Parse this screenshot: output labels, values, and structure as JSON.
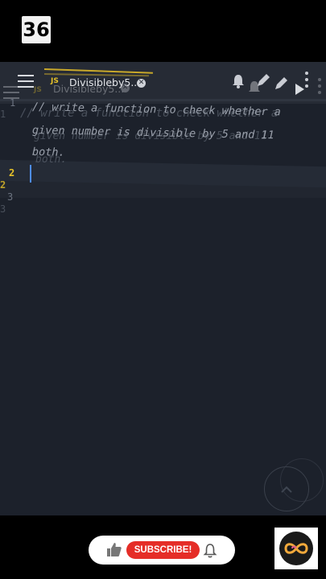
{
  "badge": {
    "label": "36"
  },
  "toolbar": {
    "tab": {
      "lang": "JS",
      "title": "Divisibleby5..",
      "title_ghost": "Divisibleby5..."
    }
  },
  "editor": {
    "gutter": [
      "1",
      "2",
      "3"
    ],
    "gutter_ghost": [
      "1",
      "2",
      "3"
    ],
    "lines": [
      "// write a function to check whether a",
      "  given number is divisible by 5 and 11",
      "  both."
    ],
    "ghost_lines": [
      "// write a function to check whether a",
      "given number is divisible by 5 and 11",
      "both."
    ]
  },
  "footer": {
    "subscribe_label": "SUBSCRIBE!"
  },
  "colors": {
    "background": "#1c212b",
    "toolbar": "#262b35",
    "accent": "#e6c229",
    "subscribe": "#e52d27"
  }
}
